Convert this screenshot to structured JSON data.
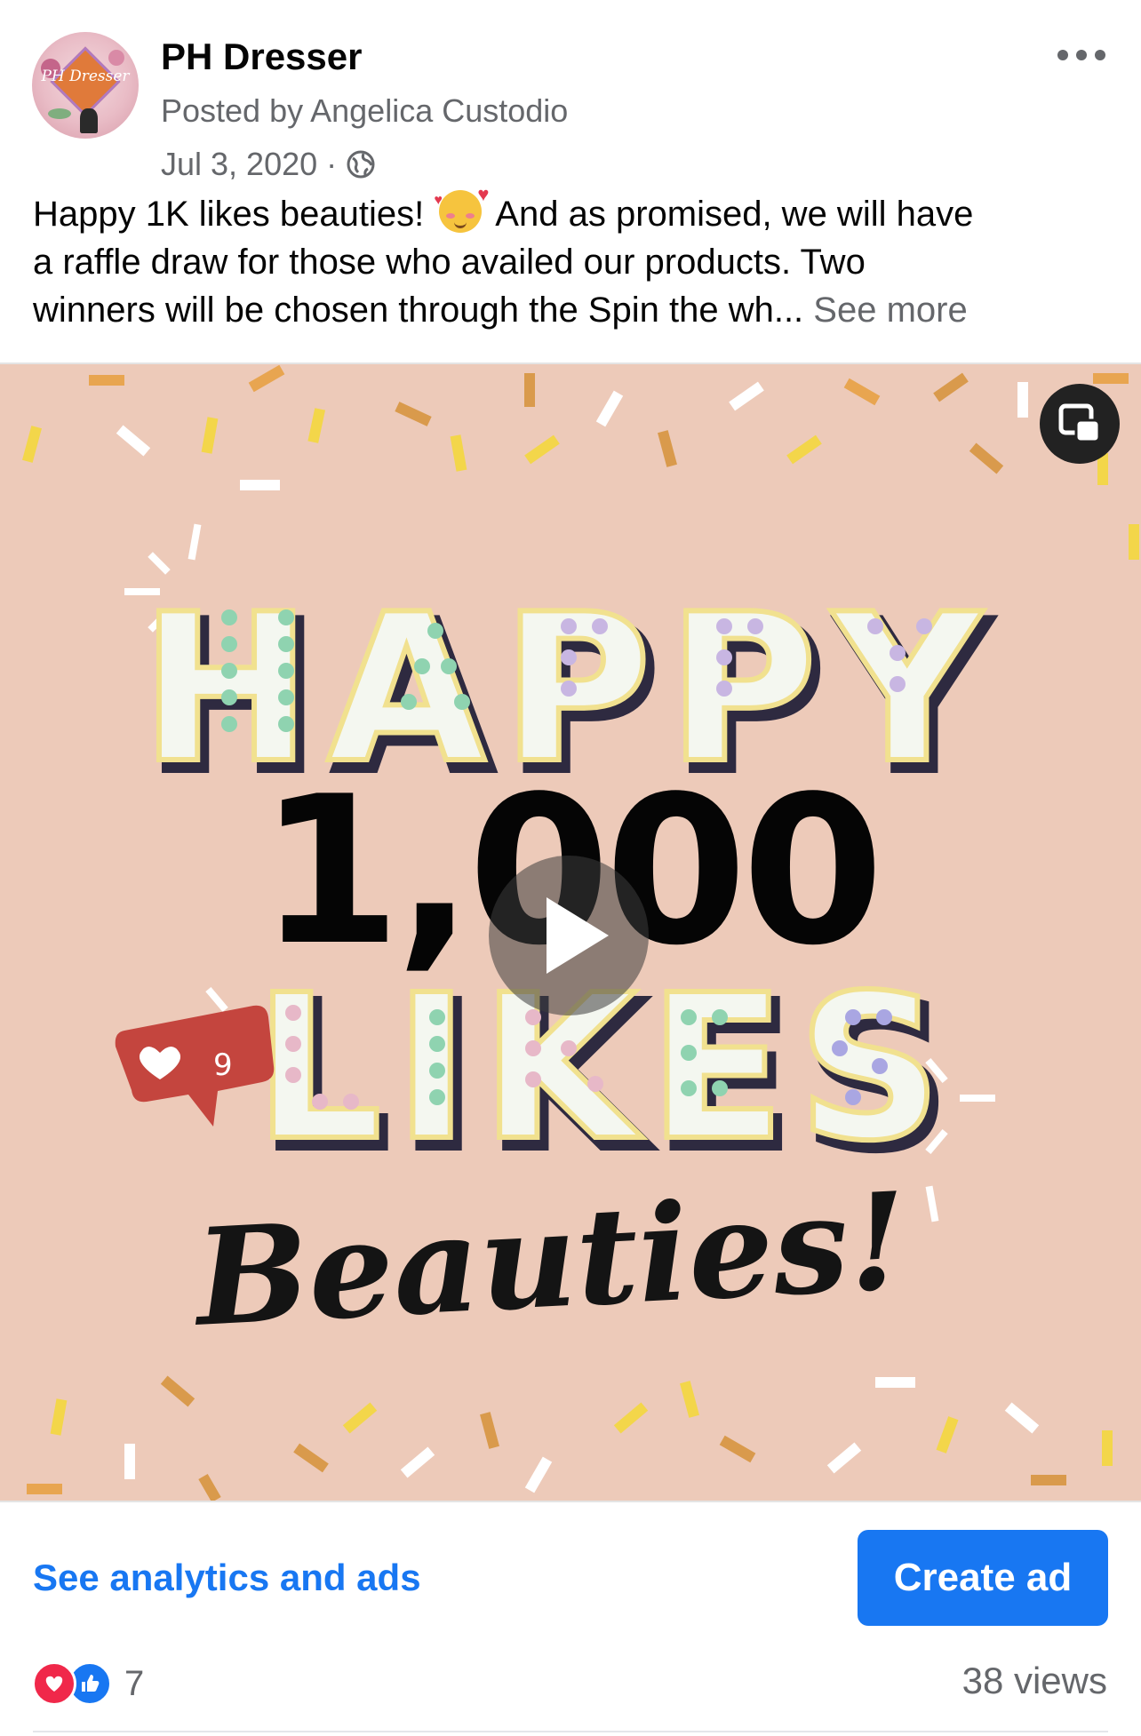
{
  "post": {
    "page_name": "PH Dresser",
    "avatar_text": "PH Dresser",
    "posted_by": "Posted by Angelica Custodio",
    "date": "Jul 3, 2020",
    "separator": "·",
    "audience_icon": "globe-icon",
    "more_icon": "more-horizontal-icon",
    "caption_line1_a": "Happy 1K likes beauties!",
    "caption_emoji": "smiling-face-with-hearts",
    "caption_line1_b": "And as promised, we will have",
    "caption_line2": "a raffle draw for those who availed our products. Two",
    "caption_line3": "winners will be chosen through the Spin the wh...",
    "see_more": "See more"
  },
  "media": {
    "type": "video",
    "text_happy": "HAPPY",
    "text_number": "1,000",
    "text_likes": "LIKES",
    "text_beauties": "Beauties!",
    "like_badge_count": "9",
    "play_icon": "play-icon",
    "pip_icon": "picture-in-picture-icon",
    "background_color": "#edcab9"
  },
  "actions": {
    "analytics_link": "See analytics and ads",
    "create_ad_label": "Create ad"
  },
  "stats": {
    "reaction_icons": [
      "love-reaction-icon",
      "like-reaction-icon"
    ],
    "reaction_count": "7",
    "views": "38 views"
  },
  "colors": {
    "accent": "#1877f2",
    "secondary_text": "#65676b",
    "love": "#f0284a"
  }
}
